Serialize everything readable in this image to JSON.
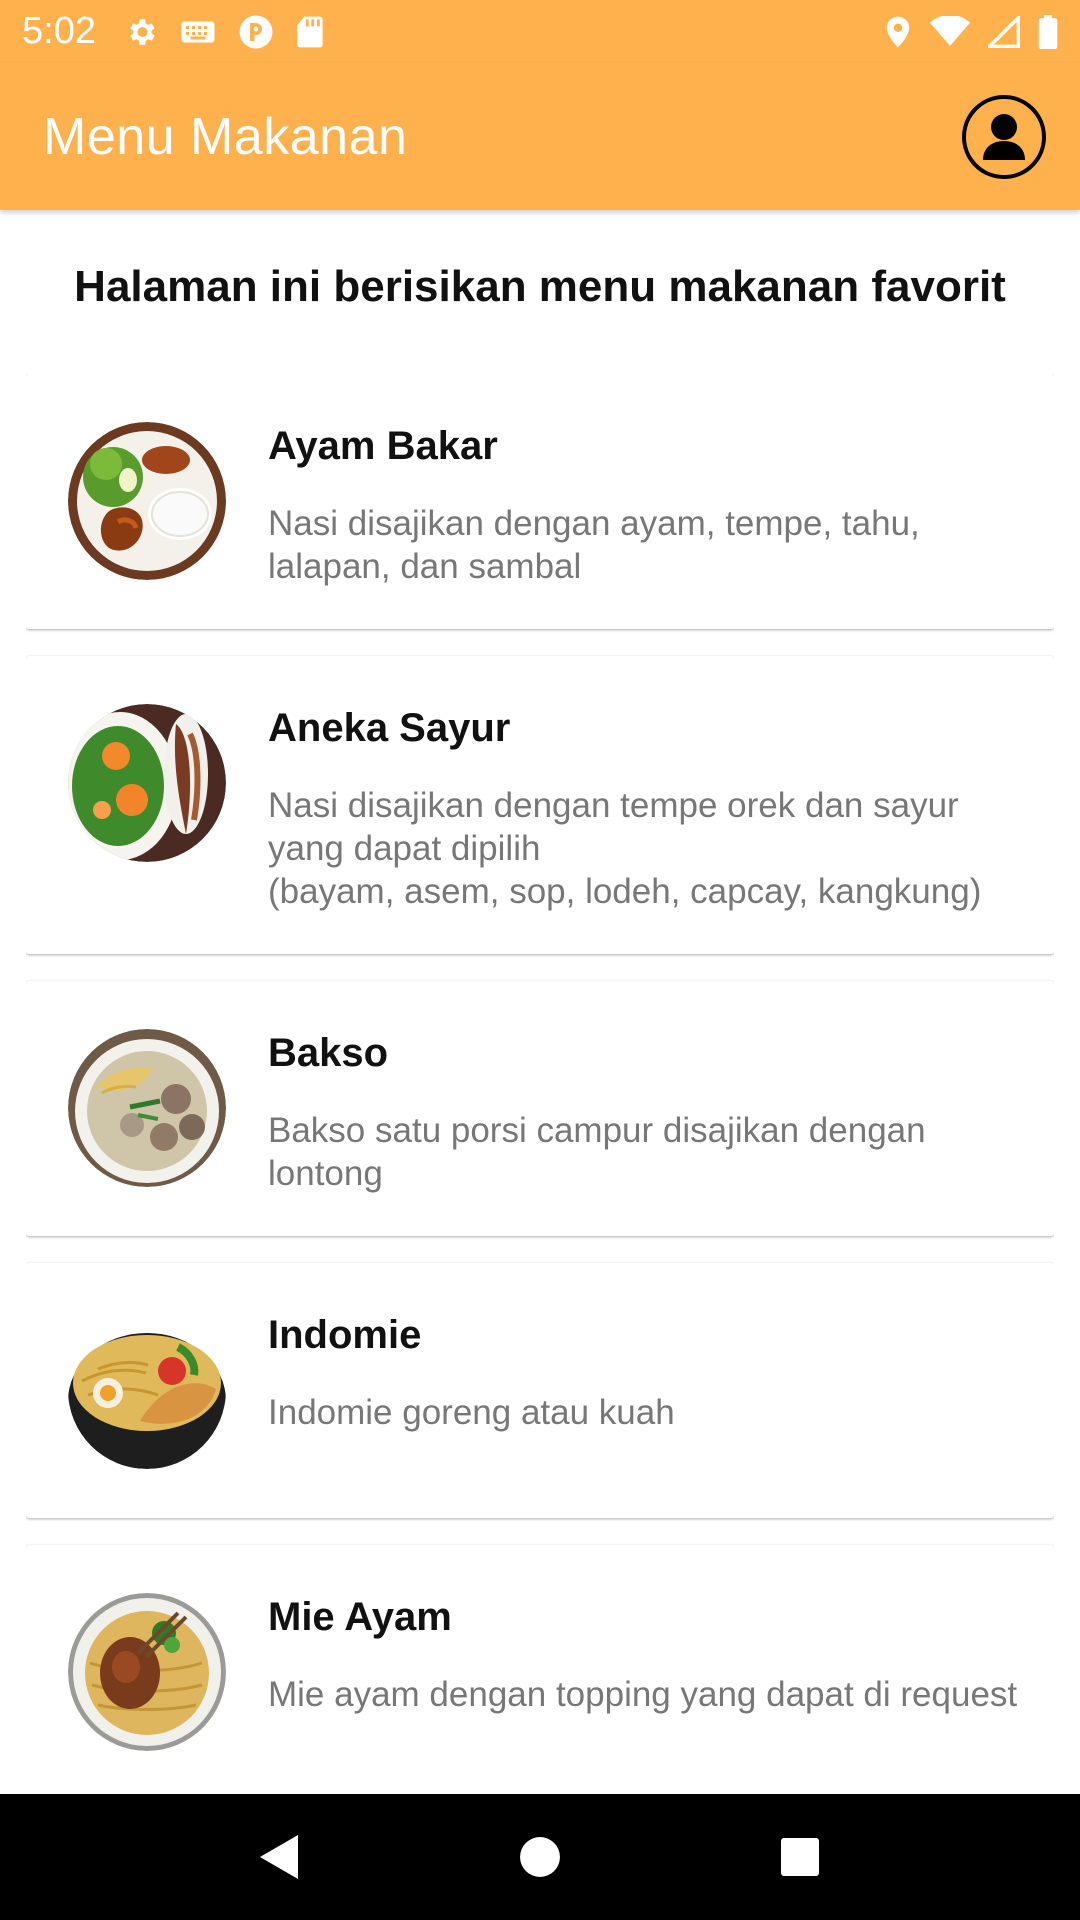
{
  "status_bar": {
    "time": "5:02",
    "left_icons": [
      "gear-icon",
      "keyboard-icon",
      "app-badge-icon",
      "sd-card-icon"
    ],
    "right_icons": [
      "location-icon",
      "wifi-icon",
      "signal-icon",
      "battery-icon"
    ]
  },
  "app_bar": {
    "title": "Menu Makanan",
    "profile_icon": "account-circle-icon",
    "color": "#FFB14E"
  },
  "heading": "Halaman ini berisikan menu makanan favorit",
  "menu_items": [
    {
      "name": "Ayam Bakar",
      "description": "Nasi disajikan dengan ayam, tempe, tahu, lalapan, dan sambal"
    },
    {
      "name": "Aneka Sayur",
      "description": "Nasi disajikan dengan tempe orek dan sayur yang dapat dipilih\n(bayam, asem, sop, lodeh, capcay, kangkung)"
    },
    {
      "name": "Bakso",
      "description": "Bakso satu porsi campur disajikan dengan lontong"
    },
    {
      "name": "Indomie",
      "description": "Indomie goreng atau kuah"
    },
    {
      "name": "Mie Ayam",
      "description": "Mie ayam dengan topping yang dapat di request"
    }
  ],
  "nav_bar": {
    "buttons": [
      "back-icon",
      "home-icon",
      "recents-icon"
    ]
  }
}
